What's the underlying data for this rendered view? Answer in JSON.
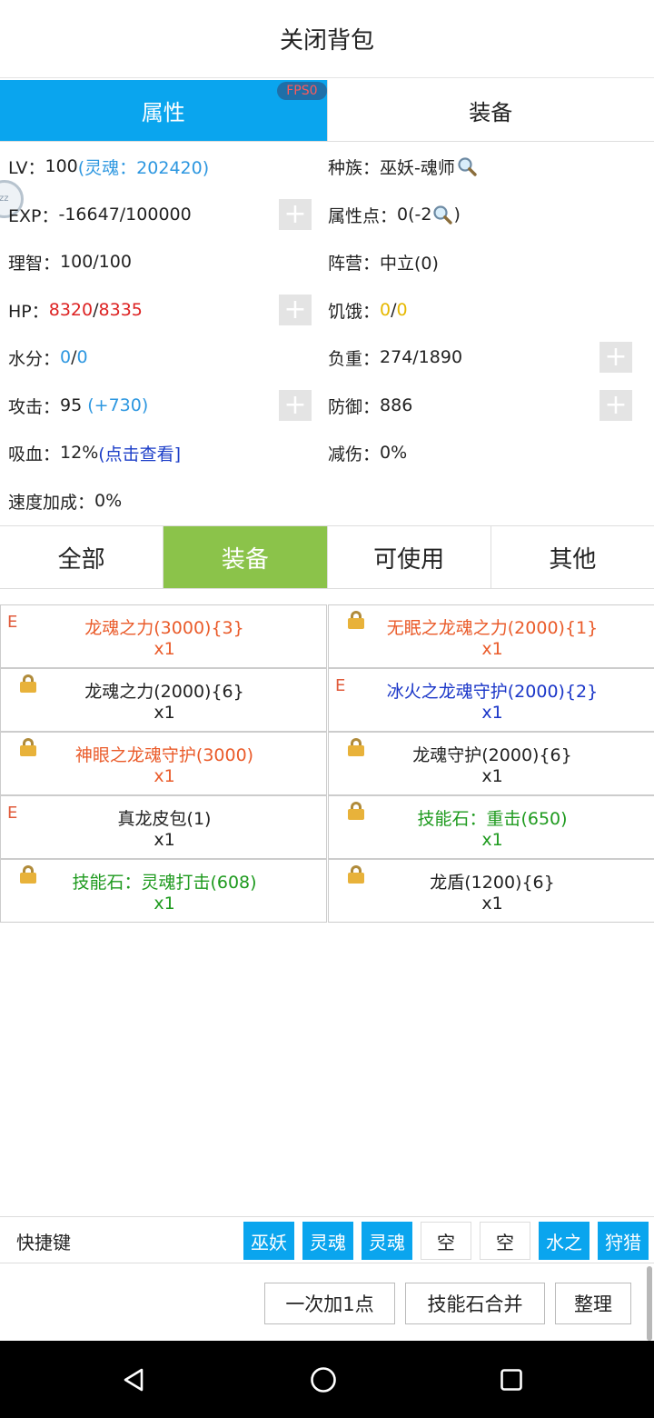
{
  "title": "关闭背包",
  "main_tabs": [
    {
      "label": "属性",
      "active": true
    },
    {
      "label": "装备",
      "active": false
    }
  ],
  "fps_badge": "FPS0",
  "attributes": {
    "lv_label": "LV：",
    "lv_value": "100",
    "lv_soul": "(灵魂：202420)",
    "race_label": "种族：",
    "race_value": "巫妖-魂师",
    "exp_label": "EXP：",
    "exp_value": "-16647/100000",
    "points_label": "属性点：",
    "points_value": "0(-2",
    "points_close": ")",
    "sanity_label": "理智：",
    "sanity_value": "100/100",
    "faction_label": "阵营：",
    "faction_value": "中立(0)",
    "hp_label": "HP：",
    "hp_current": "8320",
    "hp_sep": "/",
    "hp_max": "8335",
    "hunger_label": "饥饿：",
    "hunger_current": "0",
    "hunger_sep": "/",
    "hunger_max": "0",
    "water_label": "水分：",
    "water_current": "0",
    "water_sep": "/",
    "water_max": "0",
    "load_label": "负重：",
    "load_value": "274/1890",
    "attack_label": "攻击：",
    "attack_value": "95 ",
    "attack_bonus": "(+730)",
    "defense_label": "防御：",
    "defense_value": "886",
    "lifesteal_label": "吸血：",
    "lifesteal_value": "12%",
    "lifesteal_link": "(点击查看]",
    "damage_reduce_label": "减伤：",
    "damage_reduce_value": "0%",
    "speed_label": "速度加成：",
    "speed_value": "0%",
    "plus_label": "+"
  },
  "category_tabs": [
    {
      "label": "全部",
      "active": false
    },
    {
      "label": "装备",
      "active": true
    },
    {
      "label": "可使用",
      "active": false
    },
    {
      "label": "其他",
      "active": false
    }
  ],
  "items": [
    {
      "name": "龙魂之力(3000){3}",
      "qty": "x1",
      "marker": "E",
      "color": "orange"
    },
    {
      "name": "无眠之龙魂之力(2000){1}",
      "qty": "x1",
      "marker": "lock",
      "color": "orange"
    },
    {
      "name": "龙魂之力(2000){6}",
      "qty": "x1",
      "marker": "lock",
      "color": "black"
    },
    {
      "name": "冰火之龙魂守护(2000){2}",
      "qty": "x1",
      "marker": "E",
      "color": "blue"
    },
    {
      "name": "神眼之龙魂守护(3000)",
      "qty": "x1",
      "marker": "lock",
      "color": "orange"
    },
    {
      "name": "龙魂守护(2000){6}",
      "qty": "x1",
      "marker": "lock",
      "color": "black"
    },
    {
      "name": "真龙皮包(1)",
      "qty": "x1",
      "marker": "E",
      "color": "black"
    },
    {
      "name": "技能石：重击(650)",
      "qty": "x1",
      "marker": "lock",
      "color": "green"
    },
    {
      "name": "技能石：灵魂打击(608)",
      "qty": "x1",
      "marker": "lock",
      "color": "green"
    },
    {
      "name": "龙盾(1200){6}",
      "qty": "x1",
      "marker": "lock",
      "color": "black"
    }
  ],
  "shortcut": {
    "label": "快捷键",
    "slots": [
      {
        "label": "巫妖",
        "filled": true
      },
      {
        "label": "灵魂",
        "filled": true
      },
      {
        "label": "灵魂",
        "filled": true
      },
      {
        "label": "空",
        "filled": false
      },
      {
        "label": "空",
        "filled": false
      },
      {
        "label": "水之",
        "filled": true
      },
      {
        "label": "狩猎",
        "filled": true
      }
    ]
  },
  "actions": {
    "add_one": "一次加1点",
    "merge_stones": "技能石合并",
    "sort": "整理"
  },
  "colors": {
    "accent_blue": "#0aa5ee",
    "tab_green": "#8bc34a",
    "hp_red": "#dd2222",
    "soul_blue": "#2d97e0",
    "hunger_yellow": "#e6b800"
  },
  "icons": {
    "search": "magnifier-icon",
    "lock": "lock-icon",
    "nav_back": "triangle-back-icon",
    "nav_home": "circle-home-icon",
    "nav_recent": "square-recent-icon"
  }
}
